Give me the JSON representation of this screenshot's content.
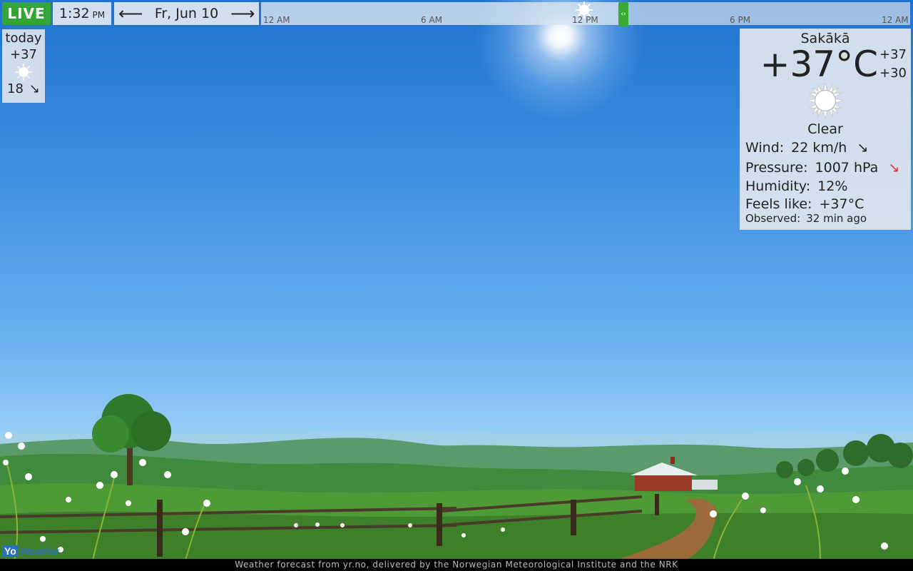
{
  "topbar": {
    "live_label": "LIVE",
    "time": "1:32",
    "ampm": "PM",
    "prev_icon": "arrow-left-icon",
    "next_icon": "arrow-right-icon",
    "date": "Fr, Jun 10",
    "timeline_ticks": [
      "12 AM",
      "6 AM",
      "12 PM",
      "6 PM",
      "12 AM"
    ],
    "timeline_icon": "sun-icon"
  },
  "today": {
    "label": "today",
    "high": "+37",
    "icon": "sun-icon",
    "wind": "18",
    "wind_arrow": "↘"
  },
  "current": {
    "city": "Sakākā",
    "temperature": "+37°C",
    "high": "+37",
    "low": "+30",
    "icon": "sun-icon",
    "condition": "Clear",
    "wind_label": "Wind:",
    "wind_value": "22 km/h",
    "wind_arrow": "↘",
    "pressure_label": "Pressure:",
    "pressure_value": "1007 hPa",
    "pressure_arrow": "↘",
    "humidity_label": "Humidity:",
    "humidity_value": "12%",
    "feels_label": "Feels like:",
    "feels_value": "+37°C",
    "observed_label": "Observed:",
    "observed_value": "32 min ago"
  },
  "colors": {
    "live_green": "#33a532",
    "pressure_arrow": "#e03030"
  },
  "footer": {
    "credit": "Weather forecast from yr.no, delivered by the Norwegian Meteorological Institute and the NRK",
    "logo_yo": "Yo",
    "logo_rest": "Weather"
  }
}
